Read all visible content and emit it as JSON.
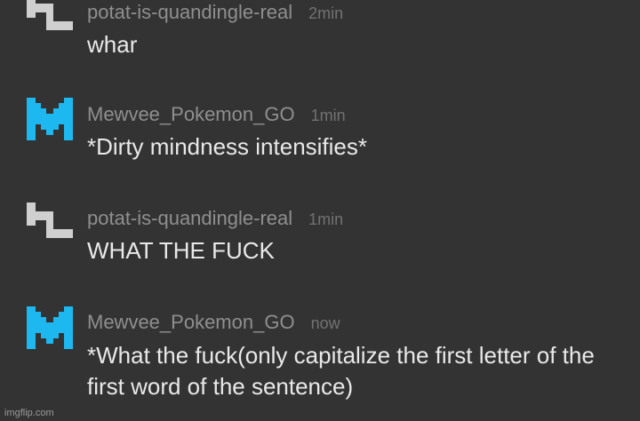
{
  "messages": [
    {
      "username": "potat-is-quandingle-real",
      "time": "2min",
      "text": "whar",
      "avatar_icon": "quandingle-pixel-icon",
      "avatar_color": "#cfcfcf"
    },
    {
      "username": "Mewvee_Pokemon_GO",
      "time": "1min",
      "text": "*Dirty mindness intensifies*",
      "avatar_icon": "miiverse-m-pixel-icon",
      "avatar_color": "#1db8f0"
    },
    {
      "username": "potat-is-quandingle-real",
      "time": "1min",
      "text": "WHAT THE FUCK",
      "avatar_icon": "quandingle-pixel-icon",
      "avatar_color": "#cfcfcf"
    },
    {
      "username": "Mewvee_Pokemon_GO",
      "time": "now",
      "text": "*What the fuck(only capitalize the first letter of the first word of the sentence)",
      "avatar_icon": "miiverse-m-pixel-icon",
      "avatar_color": "#1db8f0"
    }
  ],
  "watermark": "imgflip.com",
  "colors": {
    "background": "#333333",
    "username": "#8f8f8f",
    "timestamp": "#727272",
    "message_text": "#e9e9e9"
  }
}
